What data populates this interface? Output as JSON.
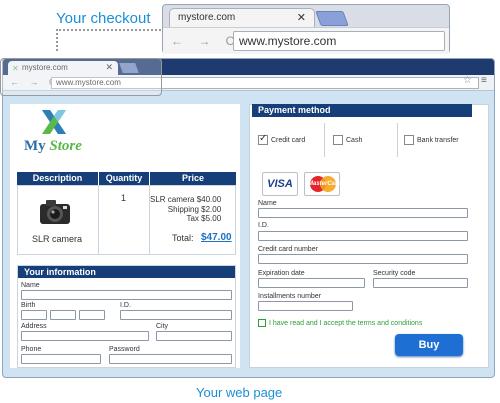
{
  "callout": {
    "label": "Your checkout"
  },
  "mini_browser": {
    "tab_title": "mystore.com",
    "close": "✕",
    "nav": "← → C",
    "url": "www.mystore.com"
  },
  "browser": {
    "tab_title": "mystore.com",
    "close": "✕",
    "nav": "← → C",
    "url": "www.mystore.com",
    "star": "☆",
    "menu": "≡"
  },
  "logo": {
    "brand_my": "My",
    "brand_store": "Store"
  },
  "order": {
    "headers": [
      "Description",
      "Quantity",
      "Price"
    ],
    "item_label": "SLR camera",
    "quantity": "1",
    "price_rows": [
      {
        "label": "SLR camera",
        "value": "$40.00"
      },
      {
        "label": "Shipping",
        "value": "$2.00"
      },
      {
        "label": "Tax",
        "value": "$5.00"
      }
    ],
    "total_label": "Total:",
    "total_value": "$47.00"
  },
  "info": {
    "title": "Your information",
    "labels": {
      "name": "Name",
      "birth": "Birth",
      "id": "I.D.",
      "address": "Address",
      "city": "City",
      "phone": "Phone",
      "password": "Password"
    }
  },
  "payment": {
    "title": "Payment method",
    "options": [
      {
        "label": "Credit card",
        "checked": true
      },
      {
        "label": "Cash",
        "checked": false
      },
      {
        "label": "Bank transfer",
        "checked": false
      }
    ],
    "cards": {
      "visa": "VISA",
      "mastercard": "MasterCard"
    },
    "labels": {
      "name": "Name",
      "id": "I.D.",
      "card_number": "Credit card number",
      "expiration": "Expiration date",
      "security": "Security code",
      "installments": "Installments number"
    },
    "terms": "I have read and I accept the terms and conditions",
    "buy": "Buy"
  },
  "footer": {
    "label": "Your web page"
  },
  "colors": {
    "accent": "#1b8fd6",
    "header": "#163f7a",
    "brand_green": "#5ab848",
    "link": "#1b73c8",
    "buy": "#1d6fd3"
  }
}
